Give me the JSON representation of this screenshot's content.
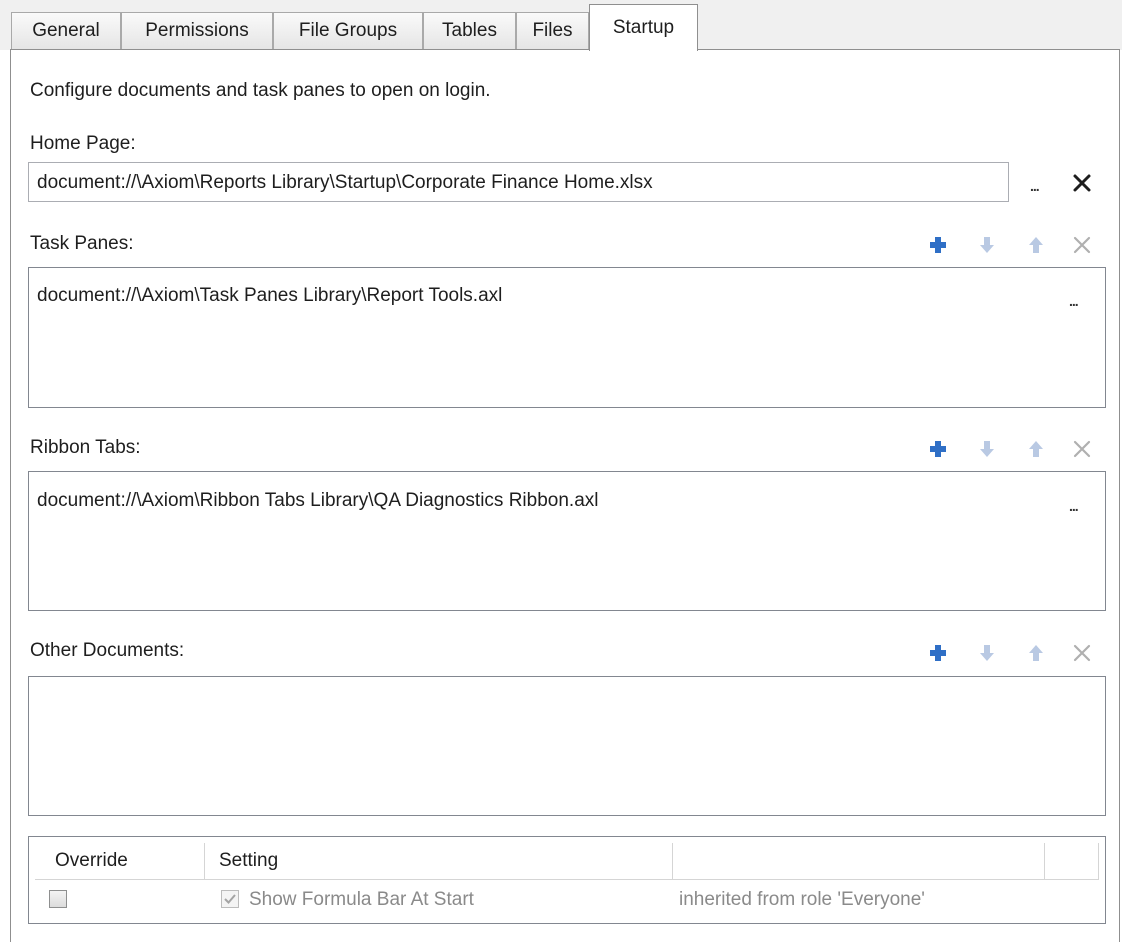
{
  "tabs": [
    {
      "label": "General"
    },
    {
      "label": "Permissions"
    },
    {
      "label": "File Groups"
    },
    {
      "label": "Tables"
    },
    {
      "label": "Files"
    },
    {
      "label": "Startup",
      "active": true
    }
  ],
  "startup": {
    "description": "Configure documents and task panes to open on login.",
    "home_page": {
      "label": "Home Page:",
      "value": "document://\\Axiom\\Reports Library\\Startup\\Corporate Finance Home.xlsx",
      "browse_label": "...",
      "clear_label": "✕"
    },
    "task_panes": {
      "label": "Task Panes:",
      "items": [
        "document://\\Axiom\\Task Panes Library\\Report Tools.axl"
      ],
      "browse_label": "..."
    },
    "ribbon_tabs": {
      "label": "Ribbon Tabs:",
      "items": [
        "document://\\Axiom\\Ribbon Tabs Library\\QA Diagnostics Ribbon.axl"
      ],
      "browse_label": "..."
    },
    "other_documents": {
      "label": "Other Documents:",
      "items": []
    },
    "settings_grid": {
      "headers": [
        "Override",
        "Setting",
        ""
      ],
      "rows": [
        {
          "override": false,
          "setting_checked": true,
          "setting_label": "Show Formula Bar At Start",
          "inherited": "inherited from role 'Everyone'"
        }
      ]
    }
  },
  "colors": {
    "add_icon": "#2f6fc6",
    "disabled_icon": "#b9c9e3",
    "clear_icon": "#1e1e1e",
    "disabled_clear_icon": "#b0b0b0"
  }
}
